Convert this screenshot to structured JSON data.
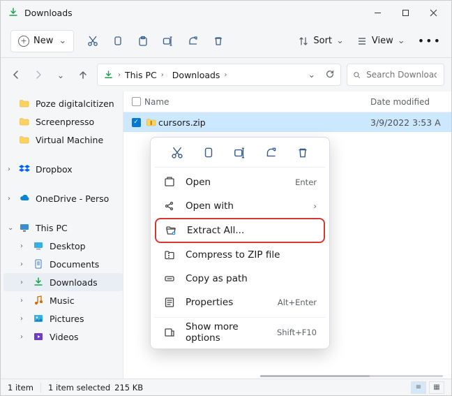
{
  "window": {
    "title": "Downloads"
  },
  "toolbar": {
    "new_label": "New",
    "sort_label": "Sort",
    "view_label": "View"
  },
  "address": {
    "crumbs": [
      "This PC",
      "Downloads"
    ]
  },
  "search": {
    "placeholder": "Search Downloads"
  },
  "sidebar": {
    "items": [
      {
        "label": "Poze digitalcitizen",
        "type": "folder"
      },
      {
        "label": "Screenpresso",
        "type": "folder"
      },
      {
        "label": "Virtual Machine",
        "type": "folder"
      },
      {
        "label": "Dropbox",
        "type": "dropbox",
        "expand": true
      },
      {
        "label": "OneDrive - Perso",
        "type": "onedrive",
        "expand": true
      },
      {
        "label": "This PC",
        "type": "pc",
        "expand": true,
        "open": true
      },
      {
        "label": "Desktop",
        "type": "desktop",
        "child": true,
        "expand": true
      },
      {
        "label": "Documents",
        "type": "docs",
        "child": true,
        "expand": true
      },
      {
        "label": "Downloads",
        "type": "downloads",
        "child": true,
        "expand": true,
        "selected": true
      },
      {
        "label": "Music",
        "type": "music",
        "child": true,
        "expand": true
      },
      {
        "label": "Pictures",
        "type": "pictures",
        "child": true,
        "expand": true
      },
      {
        "label": "Videos",
        "type": "videos",
        "child": true,
        "expand": true
      }
    ]
  },
  "columns": {
    "name_label": "Name",
    "date_label": "Date modified"
  },
  "rows": [
    {
      "name": "cursors.zip",
      "date": "3/9/2022 3:53 A",
      "selected": true
    }
  ],
  "context_menu": {
    "items": [
      {
        "label": "Open",
        "accel": "Enter",
        "icon": "open"
      },
      {
        "label": "Open with",
        "accel": "",
        "icon": "openwith",
        "submenu": true
      },
      {
        "label": "Extract All...",
        "accel": "",
        "icon": "extract",
        "highlight": true
      },
      {
        "label": "Compress to ZIP file",
        "accel": "",
        "icon": "zip"
      },
      {
        "label": "Copy as path",
        "accel": "",
        "icon": "path"
      },
      {
        "label": "Properties",
        "accel": "Alt+Enter",
        "icon": "props"
      },
      {
        "label": "Show more options",
        "accel": "Shift+F10",
        "icon": "more",
        "sep_before": true
      }
    ]
  },
  "status": {
    "count_label": "1 item",
    "sel_label": "1 item selected",
    "size_label": "215 KB"
  }
}
